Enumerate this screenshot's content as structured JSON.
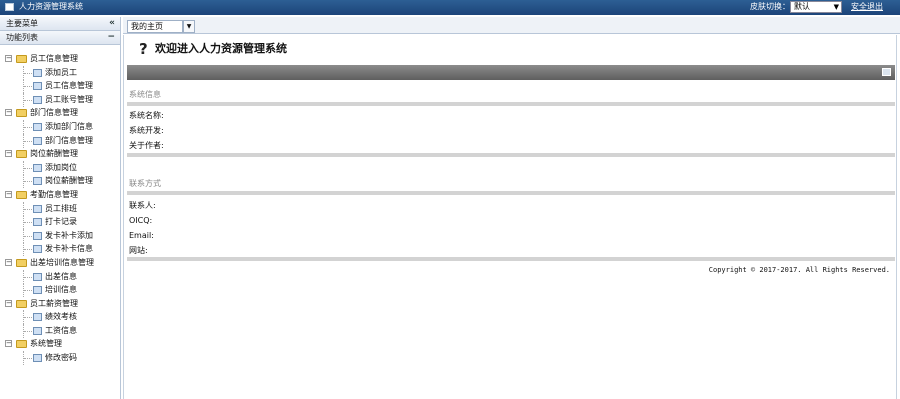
{
  "app": {
    "title": "人力资源管理系统"
  },
  "header": {
    "skin_label": "皮肤切换：",
    "skin_value": "默认",
    "logout": "安全退出"
  },
  "sidebar": {
    "main_menu": "主要菜单",
    "collapse": "«",
    "function_list": "功能列表",
    "minimize": "−",
    "groups": [
      {
        "label": "员工信息管理",
        "items": [
          "添加员工",
          "员工信息管理",
          "员工账号管理"
        ]
      },
      {
        "label": "部门信息管理",
        "items": [
          "添加部门信息",
          "部门信息管理"
        ]
      },
      {
        "label": "岗位薪酬管理",
        "items": [
          "添加岗位",
          "岗位薪酬管理"
        ]
      },
      {
        "label": "考勤信息管理",
        "items": [
          "员工排班",
          "打卡记录",
          "发卡补卡添加",
          "发卡补卡信息"
        ]
      },
      {
        "label": "出差培训信息管理",
        "items": [
          "出差信息",
          "培训信息"
        ]
      },
      {
        "label": "员工薪资管理",
        "items": [
          "绩效考核",
          "工资信息"
        ]
      },
      {
        "label": "系统管理",
        "items": [
          "修改密码"
        ]
      }
    ]
  },
  "tabs": {
    "home": "我的主页",
    "menu": "▼"
  },
  "main": {
    "welcome": "欢迎进入人力资源管理系统",
    "system_info_title": "系统信息",
    "system_name": "系统名称:",
    "system_dev": "系统开发:",
    "about_author": "关于作者:",
    "contact_title": "联系方式",
    "contact_person": "联系人:",
    "qq": "OICQ:",
    "email": "Email:",
    "website": "网站:",
    "copyright": "Copyright © 2017-2017. All Rights Reserved."
  }
}
